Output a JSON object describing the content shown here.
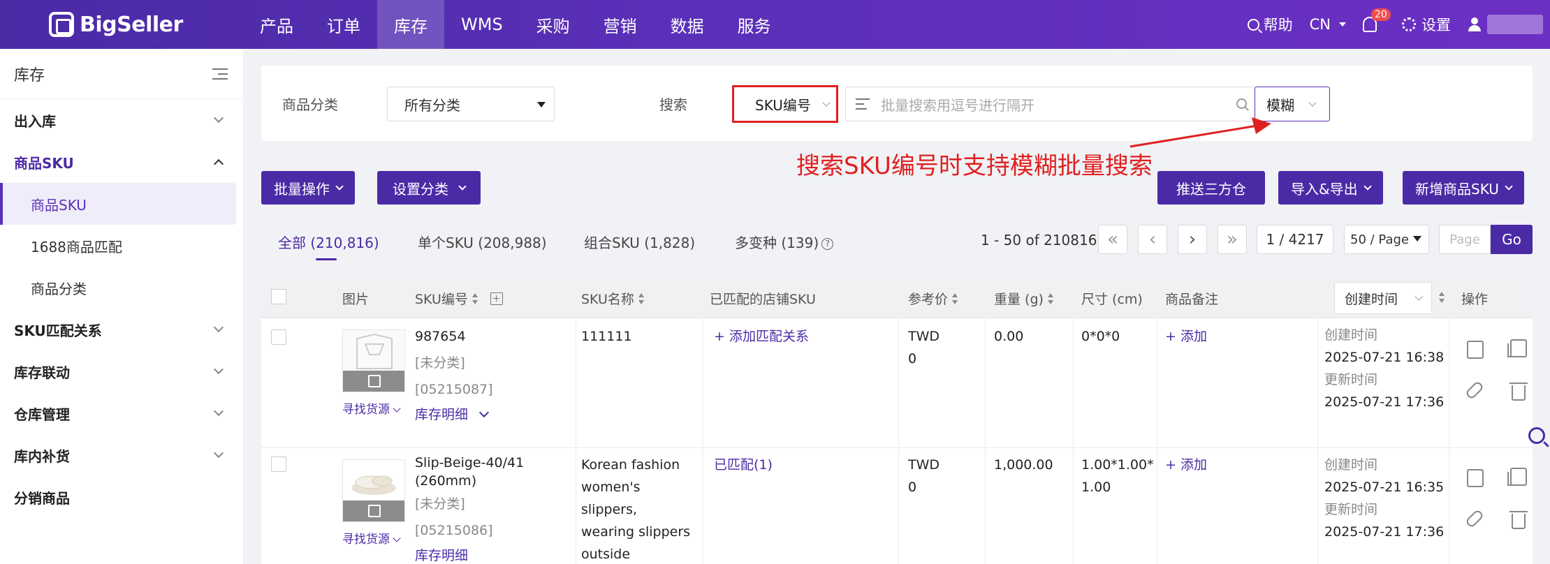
{
  "brand": "BigSeller",
  "nav": [
    "产品",
    "订单",
    "库存",
    "WMS",
    "采购",
    "营销",
    "数据",
    "服务"
  ],
  "nav_active": 2,
  "topright": {
    "help": "帮助",
    "lang": "CN",
    "notifications": "20",
    "settings": "设置"
  },
  "sidebar": {
    "title": "库存",
    "items": [
      {
        "label": "出入库",
        "type": "group"
      },
      {
        "label": "商品SKU",
        "type": "group-open"
      },
      {
        "label": "商品SKU",
        "type": "sub-active"
      },
      {
        "label": "1688商品匹配",
        "type": "sub"
      },
      {
        "label": "商品分类",
        "type": "sub"
      },
      {
        "label": "SKU匹配关系",
        "type": "group"
      },
      {
        "label": "库存联动",
        "type": "group"
      },
      {
        "label": "仓库管理",
        "type": "group"
      },
      {
        "label": "库内补货",
        "type": "group"
      },
      {
        "label": "分销商品",
        "type": "plain"
      }
    ]
  },
  "filter": {
    "category_label": "商品分类",
    "category_value": "所有分类",
    "search_label": "搜索",
    "search_field": "SKU编号",
    "search_placeholder": "批量搜索用逗号进行隔开",
    "match_mode": "模糊"
  },
  "annotation": "搜索SKU编号时支持模糊批量搜索",
  "actions": {
    "batch": "批量操作",
    "set_category": "设置分类",
    "push_3pl": "推送三方仓",
    "import_export": "导入&导出",
    "new_sku": "新增商品SKU"
  },
  "tabs": [
    {
      "label": "全部 (210,816)"
    },
    {
      "label": "单个SKU (208,988)"
    },
    {
      "label": "组合SKU (1,828)"
    },
    {
      "label": "多变种 (139)"
    }
  ],
  "pagination": {
    "range": "1 - 50 of 210816",
    "page": "1 / 4217",
    "page_size": "50 / Page",
    "jump_placeholder": "Page",
    "go": "Go"
  },
  "columns": {
    "image": "图片",
    "sku": "SKU编号",
    "name": "SKU名称",
    "matched": "已匹配的店铺SKU",
    "price": "参考价",
    "weight": "重量 (g)",
    "size": "尺寸 (cm)",
    "remark": "商品备注",
    "created_sort": "创建时间",
    "ops": "操作"
  },
  "rows": [
    {
      "sku": "987654",
      "category": "[未分类]",
      "id": "[05215087]",
      "stock_detail": "库存明细",
      "find_source": "寻找货源",
      "name": "111111",
      "matched": "+ 添加匹配关系",
      "currency": "TWD",
      "price": "0",
      "weight": "0.00",
      "size": "0*0*0",
      "remark": "+ 添加",
      "created_label": "创建时间",
      "created": "2025-07-21 16:38",
      "updated_label": "更新时间",
      "updated": "2025-07-21 17:36"
    },
    {
      "sku": "Slip-Beige-40/41 (260mm)",
      "category": "[未分类]",
      "id": "[05215086]",
      "stock_detail": "库存明细",
      "find_source": "寻找货源",
      "name": "Korean fashion women's slippers, wearing slippers outside",
      "matched": "已匹配(1)",
      "currency": "TWD",
      "price": "0",
      "weight": "1,000.00",
      "size": "1.00*1.00*1.00",
      "remark": "+ 添加",
      "created_label": "创建时间",
      "created": "2025-07-21 16:35",
      "updated_label": "更新时间",
      "updated": "2025-07-21 17:36"
    }
  ],
  "colors": {
    "primary": "#4b2aa6",
    "annotation": "#e02020"
  }
}
